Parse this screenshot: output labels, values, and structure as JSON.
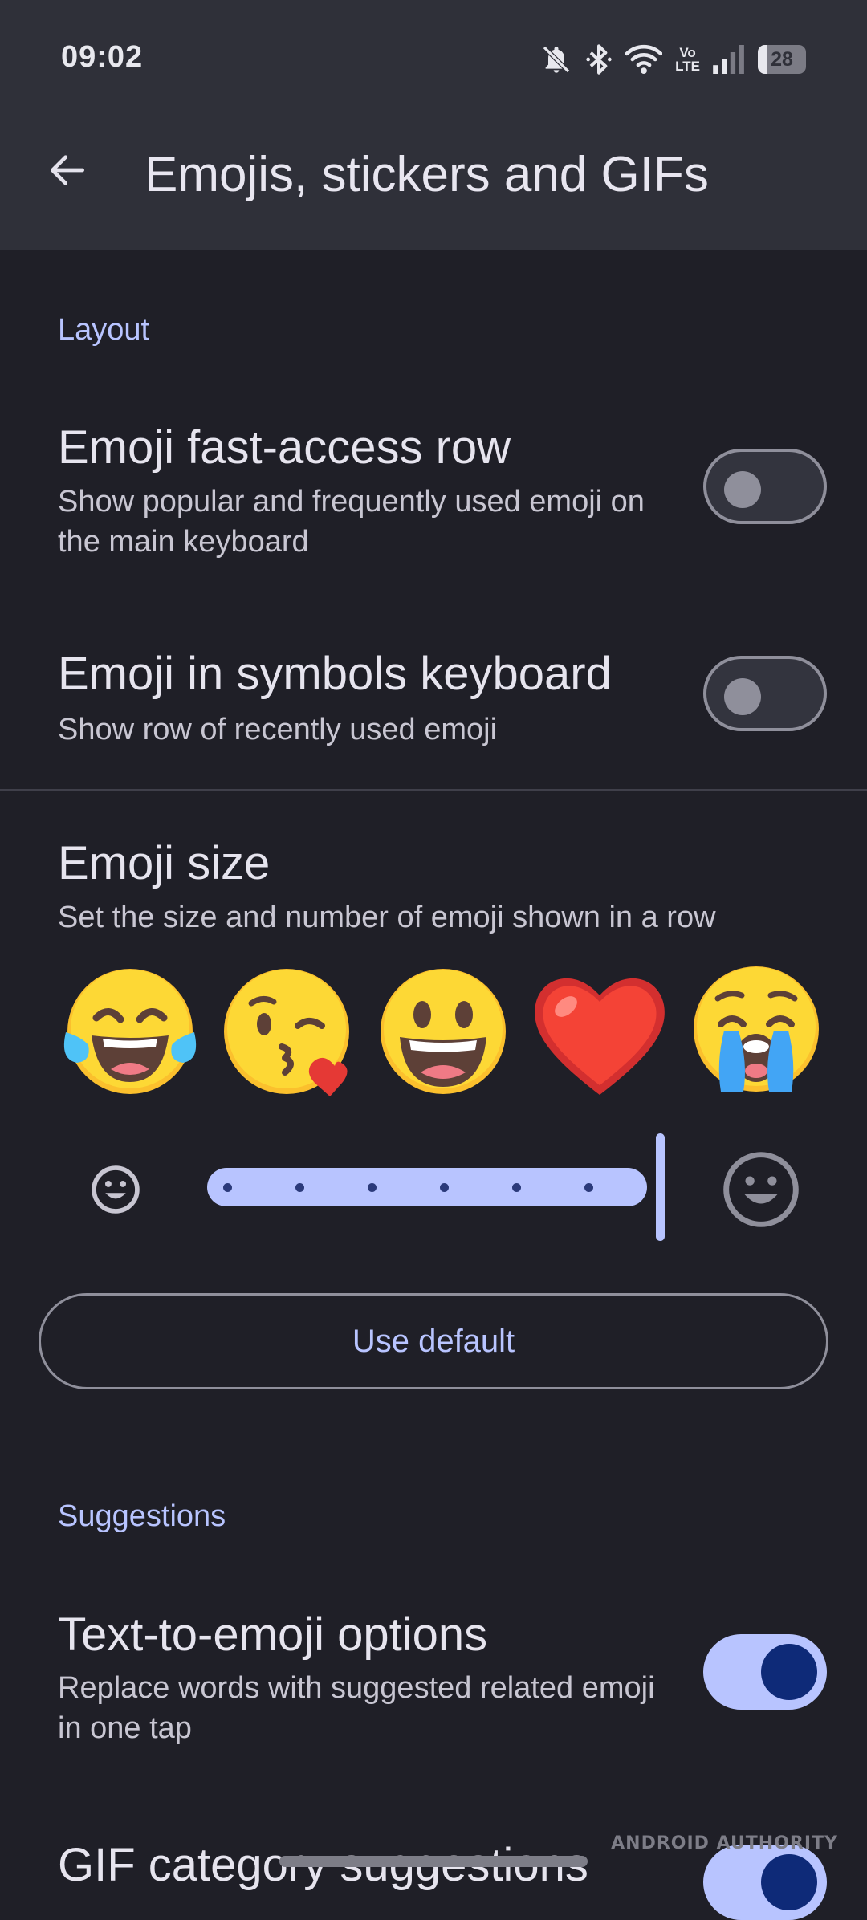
{
  "status_bar": {
    "time": "09:02",
    "icons": [
      "bell-off-icon",
      "bluetooth-icon",
      "wifi-icon",
      "volte-icon",
      "signal-icon",
      "battery-icon"
    ],
    "volte_top": "Vo",
    "volte_bottom": "LTE",
    "battery": "28"
  },
  "app_bar": {
    "back_icon": "arrow-back-icon",
    "title": "Emojis, stickers and GIFs"
  },
  "layout_section": {
    "header": "Layout",
    "items": [
      {
        "title": "Emoji fast-access row",
        "summary": "Show popular and frequently used emoji on the main keyboard",
        "enabled": false
      },
      {
        "title": "Emoji in symbols keyboard",
        "summary": "Show row of recently used emoji",
        "enabled": false
      }
    ]
  },
  "emoji_size": {
    "title": "Emoji size",
    "summary": "Set the size and number of emoji shown in a row",
    "preview": [
      "face-with-tears-of-joy",
      "face-blowing-kiss",
      "grinning-face",
      "red-heart",
      "loudly-crying-face"
    ],
    "slider": {
      "steps": 7,
      "value_fraction": 1.0,
      "min_icon": "small-smiley-icon",
      "max_icon": "large-smiley-icon"
    },
    "default_button": "Use default"
  },
  "suggestions_section": {
    "header": "Suggestions",
    "items": [
      {
        "title": "Text-to-emoji options",
        "summary": "Replace words with suggested related emoji in one tap",
        "enabled": true
      },
      {
        "title": "GIF category suggestions",
        "enabled": true
      }
    ]
  },
  "watermark": "ANDROID AUTHORITY",
  "colors": {
    "background": "#1f1f27",
    "app_bar": "#2f3039",
    "accent": "#b8c4ff",
    "switch_on_thumb": "#0e2a78"
  }
}
